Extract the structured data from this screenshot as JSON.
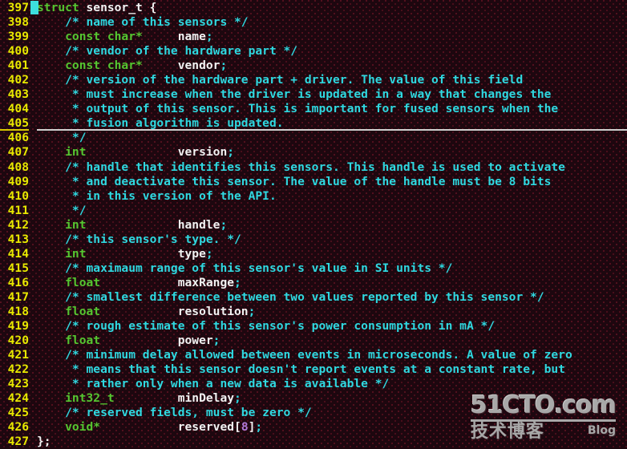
{
  "editor": {
    "kind": "terminal-text-editor",
    "language": "C",
    "background_color": "#1d070f",
    "line_number_color": "#e8e800",
    "comment_color": "#2fd8e0",
    "keyword_color": "#55c630",
    "identifier_color": "#f2f2f2",
    "number_color": "#b07ad8",
    "cursor_color": "#3ddede",
    "cursor_line": 405,
    "first_line": 397,
    "last_line": 427
  },
  "lines": [
    {
      "num": "397",
      "tokens": [
        {
          "t": "kw",
          "s": "struct"
        },
        {
          "t": "id",
          "s": " sensor_t {"
        }
      ]
    },
    {
      "num": "398",
      "tokens": [
        {
          "t": "c",
          "s": "    /* name of this sensors */"
        }
      ]
    },
    {
      "num": "399",
      "tokens": [
        {
          "t": "kw",
          "s": "    const char*"
        },
        {
          "t": "id",
          "s": "     name"
        },
        {
          "t": "pn",
          "s": ";"
        }
      ]
    },
    {
      "num": "400",
      "tokens": [
        {
          "t": "c",
          "s": "    /* vendor of the hardware part */"
        }
      ]
    },
    {
      "num": "401",
      "tokens": [
        {
          "t": "kw",
          "s": "    const char*"
        },
        {
          "t": "id",
          "s": "     vendor"
        },
        {
          "t": "pn",
          "s": ";"
        }
      ]
    },
    {
      "num": "402",
      "tokens": [
        {
          "t": "c",
          "s": "    /* version of the hardware part + driver. The value of this field"
        }
      ]
    },
    {
      "num": "403",
      "tokens": [
        {
          "t": "c",
          "s": "     * must increase when the driver is updated in a way that changes the"
        }
      ]
    },
    {
      "num": "404",
      "tokens": [
        {
          "t": "c",
          "s": "     * output of this sensor. This is important for fused sensors when the"
        }
      ]
    },
    {
      "num": "405",
      "cursor": true,
      "tokens": [
        {
          "t": "c",
          "s": "     * fusion algorithm is updated."
        }
      ]
    },
    {
      "num": "406",
      "tokens": [
        {
          "t": "c",
          "s": "     */"
        }
      ]
    },
    {
      "num": "407",
      "tokens": [
        {
          "t": "kw",
          "s": "    int"
        },
        {
          "t": "id",
          "s": "             version"
        },
        {
          "t": "pn",
          "s": ";"
        }
      ]
    },
    {
      "num": "408",
      "tokens": [
        {
          "t": "c",
          "s": "    /* handle that identifies this sensors. This handle is used to activate"
        }
      ]
    },
    {
      "num": "409",
      "tokens": [
        {
          "t": "c",
          "s": "     * and deactivate this sensor. The value of the handle must be 8 bits"
        }
      ]
    },
    {
      "num": "410",
      "tokens": [
        {
          "t": "c",
          "s": "     * in this version of the API."
        }
      ]
    },
    {
      "num": "411",
      "tokens": [
        {
          "t": "c",
          "s": "     */"
        }
      ]
    },
    {
      "num": "412",
      "tokens": [
        {
          "t": "kw",
          "s": "    int"
        },
        {
          "t": "id",
          "s": "             handle"
        },
        {
          "t": "pn",
          "s": ";"
        }
      ]
    },
    {
      "num": "413",
      "tokens": [
        {
          "t": "c",
          "s": "    /* this sensor's type. */"
        }
      ]
    },
    {
      "num": "414",
      "tokens": [
        {
          "t": "kw",
          "s": "    int"
        },
        {
          "t": "id",
          "s": "             type"
        },
        {
          "t": "pn",
          "s": ";"
        }
      ]
    },
    {
      "num": "415",
      "tokens": [
        {
          "t": "c",
          "s": "    /* maximaum range of this sensor's value in SI units */"
        }
      ]
    },
    {
      "num": "416",
      "tokens": [
        {
          "t": "kw",
          "s": "    float"
        },
        {
          "t": "id",
          "s": "           maxRange"
        },
        {
          "t": "pn",
          "s": ";"
        }
      ]
    },
    {
      "num": "417",
      "tokens": [
        {
          "t": "c",
          "s": "    /* smallest difference between two values reported by this sensor */"
        }
      ]
    },
    {
      "num": "418",
      "tokens": [
        {
          "t": "kw",
          "s": "    float"
        },
        {
          "t": "id",
          "s": "           resolution"
        },
        {
          "t": "pn",
          "s": ";"
        }
      ]
    },
    {
      "num": "419",
      "tokens": [
        {
          "t": "c",
          "s": "    /* rough estimate of this sensor's power consumption in mA */"
        }
      ]
    },
    {
      "num": "420",
      "tokens": [
        {
          "t": "kw",
          "s": "    float"
        },
        {
          "t": "id",
          "s": "           power"
        },
        {
          "t": "pn",
          "s": ";"
        }
      ]
    },
    {
      "num": "421",
      "tokens": [
        {
          "t": "c",
          "s": "    /* minimum delay allowed between events in microseconds. A value of zero"
        }
      ]
    },
    {
      "num": "422",
      "tokens": [
        {
          "t": "c",
          "s": "     * means that this sensor doesn't report events at a constant rate, but"
        }
      ]
    },
    {
      "num": "423",
      "tokens": [
        {
          "t": "c",
          "s": "     * rather only when a new data is available */"
        }
      ]
    },
    {
      "num": "424",
      "tokens": [
        {
          "t": "kw",
          "s": "    int32_t"
        },
        {
          "t": "id",
          "s": "         minDelay"
        },
        {
          "t": "pn",
          "s": ";"
        }
      ]
    },
    {
      "num": "425",
      "tokens": [
        {
          "t": "c",
          "s": "    /* reserved fields, must be zero */"
        }
      ]
    },
    {
      "num": "426",
      "tokens": [
        {
          "t": "kw",
          "s": "    void*"
        },
        {
          "t": "id",
          "s": "           reserved"
        },
        {
          "t": "br",
          "s": "["
        },
        {
          "t": "num",
          "s": "8"
        },
        {
          "t": "br",
          "s": "]"
        },
        {
          "t": "pn",
          "s": ";"
        }
      ]
    },
    {
      "num": "427",
      "tokens": [
        {
          "t": "id",
          "s": "};"
        }
      ]
    }
  ],
  "watermark": {
    "main": "51CTO.com",
    "subtitle_cn": "技术博客",
    "subtitle_en": "Blog"
  }
}
